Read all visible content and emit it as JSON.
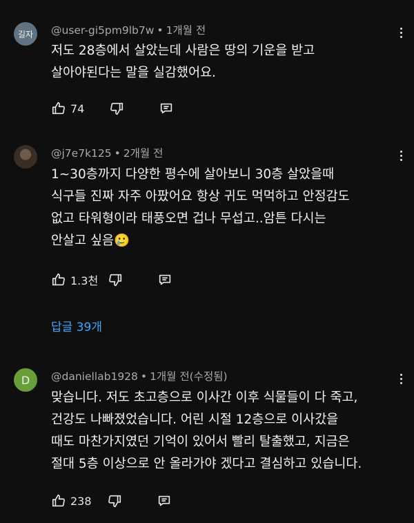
{
  "comments": [
    {
      "avatar_text": "길자",
      "avatar_color": "#5f7382",
      "handle": "@user-gi5pm9lb7w",
      "time": "1개월 전",
      "lines": [
        "저도 28층에서 살았는데 사람은 땅의 기운을 받고",
        "살아야된다는 말을 실감했어요."
      ],
      "likes": "74"
    },
    {
      "avatar_text": "",
      "avatar_color": "#4a3b30",
      "handle": "@j7e7k125",
      "time": "2개월 전",
      "lines": [
        "1~30층까지 다양한 평수에 살아보니 30층 살았을때",
        "식구들 진짜 자주 아팠어요 항상 귀도 먹먹하고 안정감도",
        "없고 타워형이라 태풍오면 겁나 무섭고..암튼 다시는",
        "안살고 싶음🥲"
      ],
      "likes": "1.3천"
    },
    {
      "avatar_text": "D",
      "avatar_color": "#689f38",
      "handle": "@daniellab1928",
      "time": "1개월 전(수정됨)",
      "lines": [
        "맞습니다. 저도 초고층으로 이사간 이후 식물들이 다 죽고,",
        "건강도 나빠졌었습니다. 어린 시절 12층으로 이사갔을",
        "때도 마찬가지였던 기억이 있어서 빨리 탈출했고, 지금은",
        "절대 5층 이상으로 안 올라가야 겠다고 결심하고 있습니다."
      ],
      "likes": "238"
    }
  ],
  "replies_label": "답글 39개",
  "meta_separator": "•"
}
